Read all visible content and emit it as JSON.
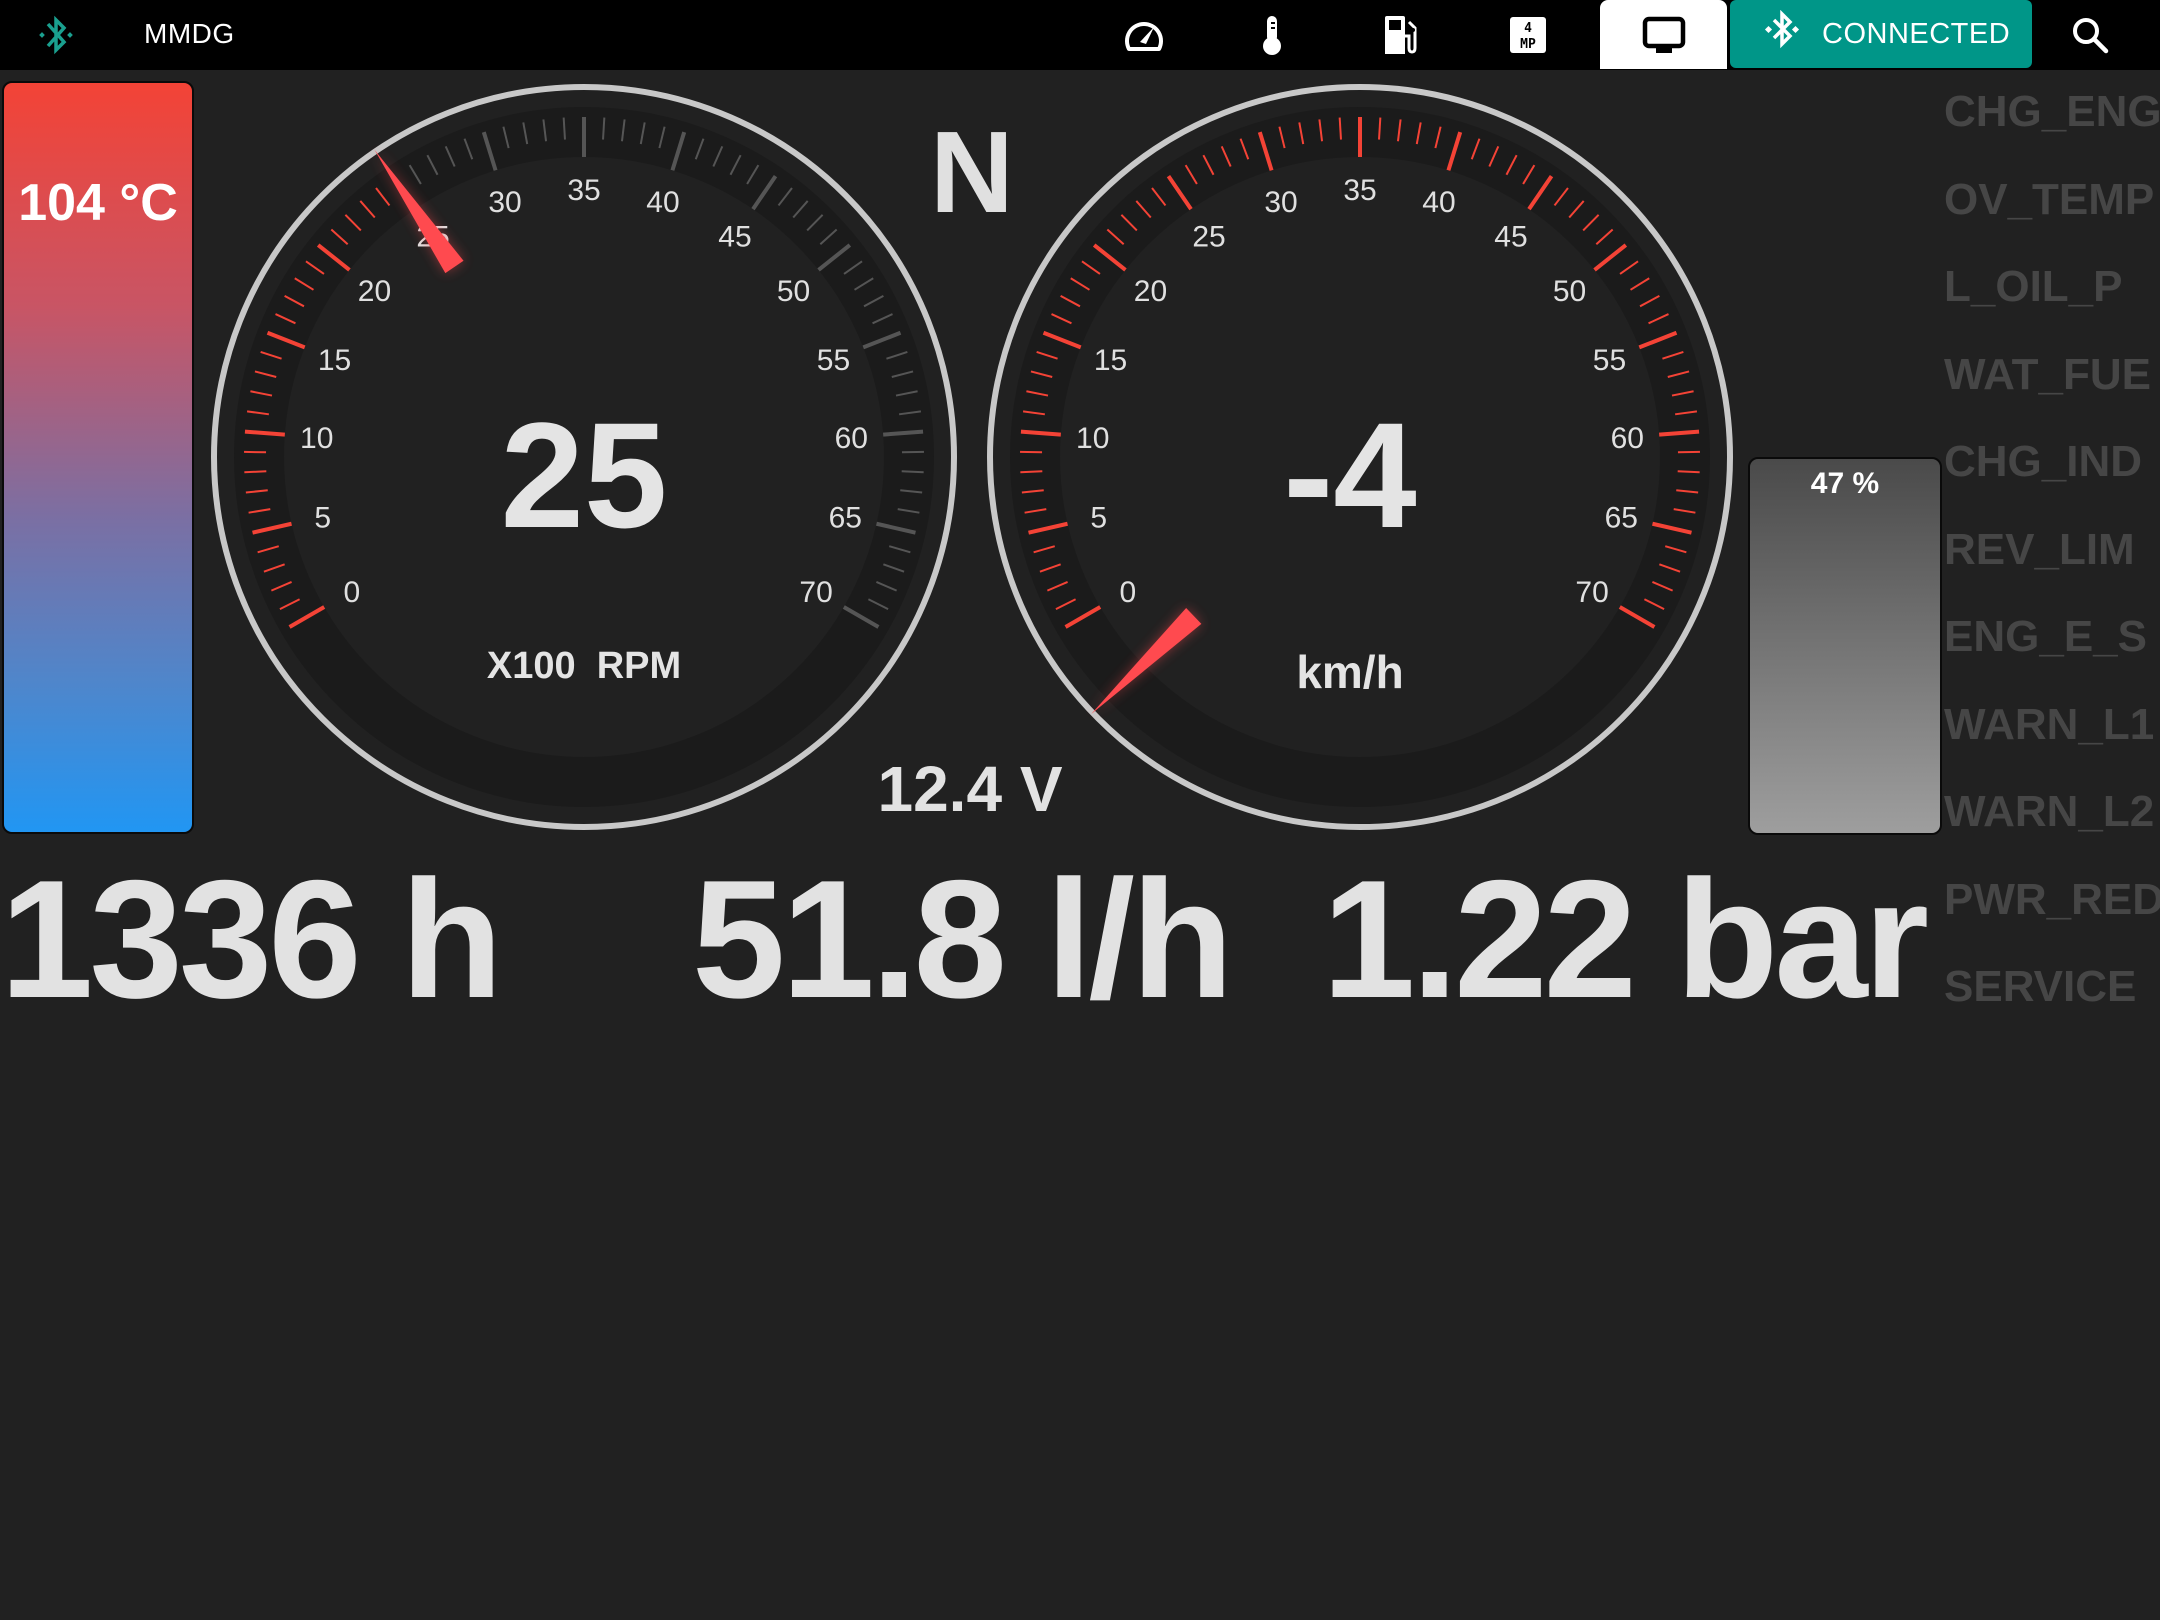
{
  "topbar": {
    "logo_icon": "bluetooth-icon",
    "title": "MMDG",
    "nav": [
      {
        "id": "dashboard",
        "icon": "speedometer-icon",
        "active": false
      },
      {
        "id": "temperature",
        "icon": "thermometer-icon",
        "active": false
      },
      {
        "id": "fuel",
        "icon": "fuel-pump-icon",
        "active": false
      },
      {
        "id": "gear",
        "icon": "manual-gear-icon",
        "active": false
      },
      {
        "id": "display",
        "icon": "monitor-icon",
        "active": true
      }
    ],
    "connection": {
      "icon": "bluetooth-icon",
      "label": "CONNECTED",
      "color": "#009688"
    },
    "search_icon": "search-icon"
  },
  "coolant_temp": {
    "label": "104 °C",
    "value": 104,
    "unit": "°C"
  },
  "tachometer": {
    "value": 25,
    "display": "25",
    "unit_label": "X100  RPM",
    "min": 0,
    "max": 70,
    "major_step": 5,
    "minor_step": 1,
    "tick_labels": [
      "0",
      "5",
      "10",
      "15",
      "20",
      "25",
      "30",
      "35",
      "40",
      "45",
      "50",
      "55",
      "60",
      "65",
      "70"
    ]
  },
  "speedometer": {
    "value": -4,
    "display": "-4",
    "unit_label": "km/h",
    "min": 0,
    "max": 70,
    "major_step": 5,
    "minor_step": 1,
    "tick_labels": [
      "0",
      "5",
      "10",
      "15",
      "20",
      "25",
      "30",
      "35",
      "40",
      "45",
      "50",
      "55",
      "60",
      "65",
      "70"
    ]
  },
  "gear": {
    "value": "N"
  },
  "voltage": {
    "label": "12.4 V",
    "value": 12.4,
    "unit": "V"
  },
  "fuel_level": {
    "label": "47 %",
    "percent": 47
  },
  "readouts": {
    "engine_hours": "1336 h",
    "fuel_rate": "51.8 l/h",
    "pressure": "1.22 bar"
  },
  "warnings": [
    "CHG_ENG",
    "OV_TEMP",
    "L_OIL_P",
    "WAT_FUE",
    "CHG_IND",
    "REV_LIM",
    "ENG_E_S",
    "WARN_L1",
    "WARN_L2",
    "PWR_RED",
    "SERVICE"
  ],
  "colors": {
    "needle": "#ff4a4f",
    "tick_active": "#f44336",
    "tick_inactive": "#555555",
    "ring": "#c8c8c8",
    "background": "#212121",
    "warning_inactive": "#464646"
  }
}
